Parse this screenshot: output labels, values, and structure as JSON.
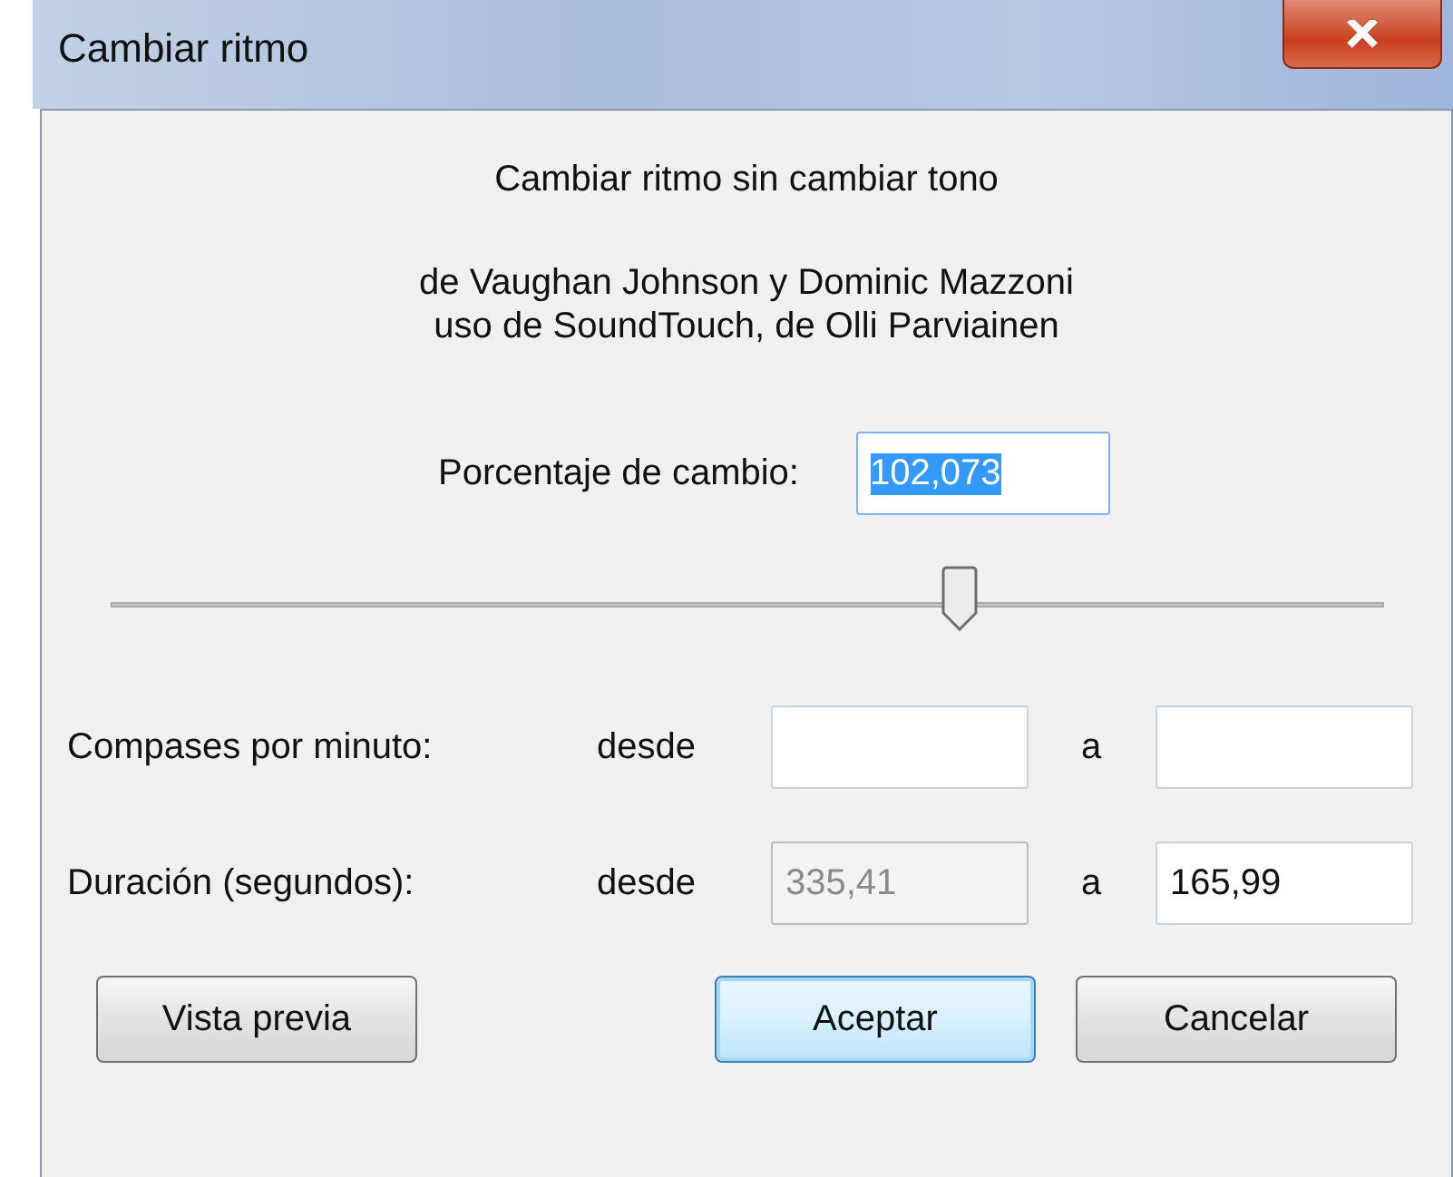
{
  "window": {
    "title": "Cambiar ritmo"
  },
  "description": "Cambiar ritmo sin cambiar tono",
  "credits": [
    "de Vaughan Johnson y Dominic Mazzoni",
    "uso de SoundTouch, de Olli Parviainen"
  ],
  "percent": {
    "label": "Porcentaje de cambio:",
    "value": "102,073",
    "text_selected": true
  },
  "slider": {
    "level": 0.667
  },
  "rows": [
    {
      "label": "Compases por minuto:",
      "from_label": "desde",
      "from": {
        "disabled": false
      },
      "to_label": "a",
      "to": {
        "disabled": false
      }
    },
    {
      "label": "Duración (segundos):",
      "from_label": "desde",
      "from": {
        "value": "335,41",
        "disabled": true
      },
      "to_label": "a",
      "to": {
        "value": "165,99",
        "disabled": false
      }
    }
  ],
  "buttons": [
    {
      "label": "Vista previa",
      "default": false
    },
    {
      "label": "Aceptar",
      "default": true
    },
    {
      "label": "Cancelar",
      "default": false
    }
  ]
}
